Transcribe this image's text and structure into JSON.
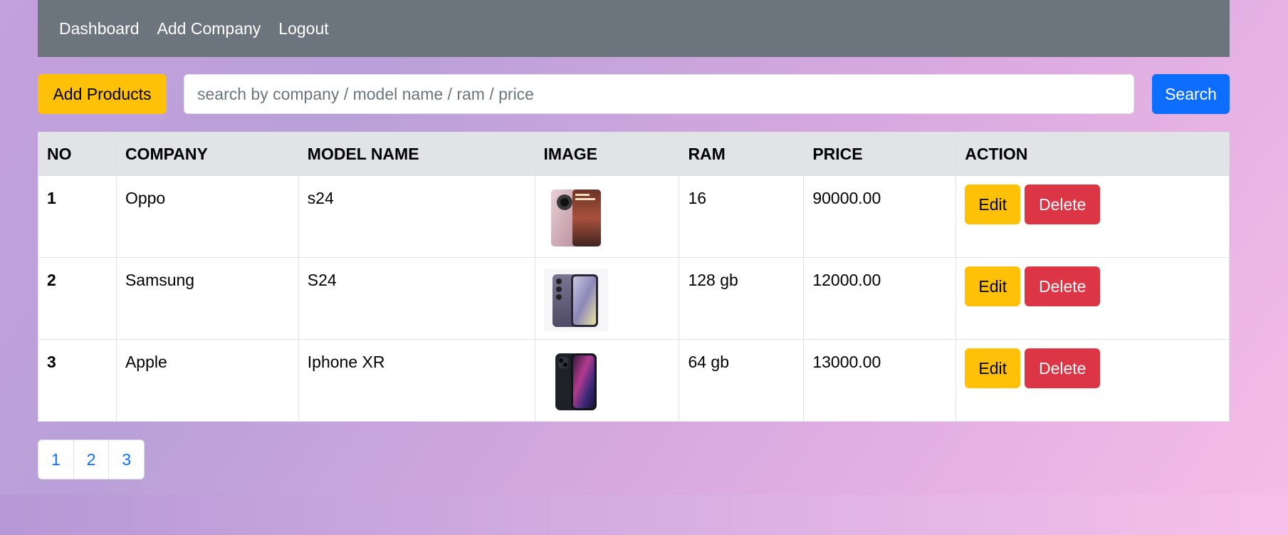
{
  "nav": {
    "links": [
      "Dashboard",
      "Add Company",
      "Logout"
    ]
  },
  "toolbar": {
    "add_label": "Add Products",
    "search_placeholder": "search by company / model name / ram / price",
    "search_label": "Search"
  },
  "table": {
    "headers": [
      "NO",
      "COMPANY",
      "MODEL NAME",
      "IMAGE",
      "RAM",
      "PRICE",
      "ACTION"
    ],
    "rows": [
      {
        "no": "1",
        "company": "Oppo",
        "model": "s24",
        "image": "oppo-phone-thumbnail",
        "ram": "16",
        "price": "90000.00"
      },
      {
        "no": "2",
        "company": "Samsung",
        "model": "S24",
        "image": "samsung-phone-thumbnail",
        "ram": "128 gb",
        "price": "12000.00"
      },
      {
        "no": "3",
        "company": "Apple",
        "model": "Iphone XR",
        "image": "iphone-thumbnail",
        "ram": "64 gb",
        "price": "13000.00"
      }
    ],
    "edit_label": "Edit",
    "delete_label": "Delete"
  },
  "pagination": [
    "1",
    "2",
    "3"
  ],
  "colors": {
    "navbar": "#6c757d",
    "warning": "#ffc107",
    "primary": "#0d6efd",
    "danger": "#dc3545"
  }
}
